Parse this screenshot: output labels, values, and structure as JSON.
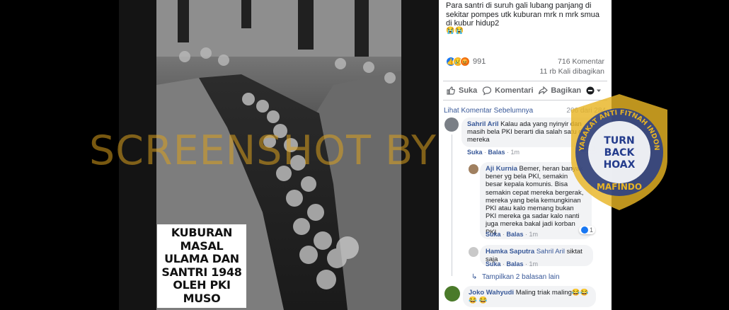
{
  "image": {
    "caption_lines": [
      "KUBURAN",
      "MASAL",
      "ULAMA DAN",
      "SANTRI 1948",
      "OLEH PKI",
      "MUSO"
    ],
    "watermark": "SCREENSHOT BY"
  },
  "badge": {
    "ring_text": "MASYARAKAT ANTI FITNAH INDONESIA",
    "bottom_text": "MAFINDO",
    "center_text": [
      "TURN",
      "BACK",
      "HOAX"
    ]
  },
  "post": {
    "text": "Para santri di suruh gali lubang panjang di sekitar pompes utk kuburan mrk n mrk smua di kubur hidup2",
    "emoji": "😭😭",
    "reaction_count": "991",
    "comment_count": "716 Komentar",
    "share_count": "11 rb Kali dibagikan",
    "actions": {
      "like": "Suka",
      "comment": "Komentari",
      "share": "Bagikan"
    }
  },
  "comments_header": {
    "previous_link": "Lihat Komentar Sebelumnya",
    "count": "206 dari 284"
  },
  "comments": [
    {
      "author": "Sahril Aril",
      "text": "Kalau ada yang nyinyir dan masih bela PKI berarti dia salah satu dari mereka",
      "like": "Suka",
      "reply": "Balas",
      "time": "1m",
      "reactions": "10"
    },
    {
      "author": "Aji Kurnia",
      "text": "Bemer, heran banyak bener yg bela PKI, semakin besar kepala komunis. Bisa semakin cepat mereka bergerak, mereka yang bela kemungkinan PKI atau kalo memang bukan PKI mereka ga sadar kalo nanti juga mereka bakal jadi korban PKI",
      "like": "Suka",
      "reply": "Balas",
      "time": "1m",
      "reactions": "1"
    },
    {
      "author": "Hamka Saputra",
      "mention": "Sahril Aril",
      "text": "siktat saja",
      "like": "Suka",
      "reply": "Balas",
      "time": "1m"
    },
    {
      "author": "Joko Wahyudi",
      "text": "Maling triak maling😂😂😂",
      "emoji_tail": "😂"
    }
  ],
  "more_replies": "Tampilkan 2 balasan lain",
  "colors": {
    "link": "#385898",
    "watermark": "#daa01e",
    "badge_blue": "#233b8c",
    "badge_gold": "#e8b424"
  }
}
